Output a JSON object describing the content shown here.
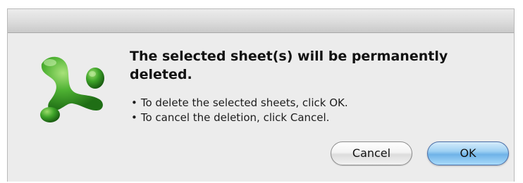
{
  "dialog": {
    "heading": "The selected sheet(s) will be permanently deleted.",
    "bullets": [
      "To delete the selected sheets, click OK.",
      "To cancel the deletion, click Cancel."
    ],
    "icon": "excel-app-icon",
    "buttons": {
      "cancel_label": "Cancel",
      "ok_label": "OK"
    }
  },
  "colors": {
    "dialog_background": "#ececec",
    "icon_green": "#3fa52a",
    "default_button_blue": "#6fb3e8"
  }
}
